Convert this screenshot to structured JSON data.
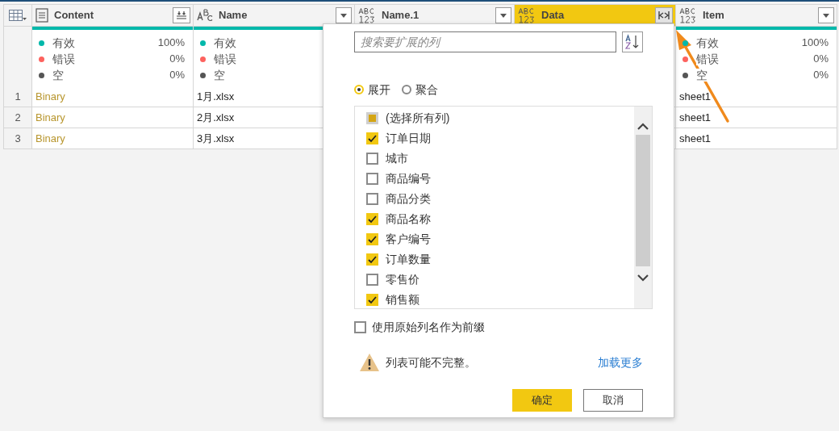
{
  "table": {
    "columns": [
      {
        "name": "Content",
        "kind": "binary",
        "header_button": {
          "kind": "expand"
        },
        "selected": false,
        "quality": [
          {
            "label": "有效",
            "value": "100%",
            "color": "#01b8aa"
          },
          {
            "label": "错误",
            "value": "0%",
            "color": "#fd625e"
          },
          {
            "label": "空",
            "value": "0%",
            "color": "#555555"
          }
        ]
      },
      {
        "name": "Name",
        "kind": "text",
        "header_button": {
          "kind": "filter"
        },
        "selected": false,
        "quality": [
          {
            "label": "有效",
            "color": "#01b8aa"
          },
          {
            "label": "错误",
            "color": "#fd625e"
          },
          {
            "label": "空",
            "color": "#555555"
          }
        ]
      },
      {
        "name": "Name.1",
        "kind": "any",
        "header_button": {
          "kind": "filter"
        },
        "selected": false
      },
      {
        "name": "Data",
        "kind": "any",
        "header_button": {
          "kind": "expand"
        },
        "selected": true
      },
      {
        "name": "Item",
        "kind": "any",
        "header_button": {
          "kind": "filter"
        },
        "selected": false,
        "quality": [
          {
            "label": "有效",
            "value": "100%",
            "color": "#01b8aa"
          },
          {
            "label": "错误",
            "value": "0%",
            "color": "#fd625e"
          },
          {
            "label": "空",
            "value": "0%",
            "color": "#555555"
          }
        ]
      }
    ],
    "rows": [
      {
        "number": "1",
        "cells": [
          "Binary",
          "1月.xlsx",
          null,
          null,
          "sheet1"
        ]
      },
      {
        "number": "2",
        "cells": [
          "Binary",
          "2月.xlsx",
          null,
          null,
          "sheet1"
        ]
      },
      {
        "number": "3",
        "cells": [
          "Binary",
          "3月.xlsx",
          null,
          null,
          "sheet1"
        ]
      }
    ]
  },
  "expand_dialog": {
    "search": {
      "placeholder": "搜索要扩展的列"
    },
    "modes": [
      {
        "label": "展开",
        "selected": true
      },
      {
        "label": "聚合",
        "selected": false
      }
    ],
    "columns": [
      {
        "label": "(选择所有列)",
        "checked": false,
        "kind": "select-all"
      },
      {
        "label": "订单日期",
        "checked": true,
        "kind": "column"
      },
      {
        "label": "城市",
        "checked": false,
        "kind": "column"
      },
      {
        "label": "商品编号",
        "checked": false,
        "kind": "column"
      },
      {
        "label": "商品分类",
        "checked": false,
        "kind": "column"
      },
      {
        "label": "商品名称",
        "checked": true,
        "kind": "column"
      },
      {
        "label": "客户编号",
        "checked": true,
        "kind": "column"
      },
      {
        "label": "订单数量",
        "checked": true,
        "kind": "column"
      },
      {
        "label": "零售价",
        "checked": false,
        "kind": "column"
      },
      {
        "label": "销售额",
        "checked": true,
        "kind": "column"
      }
    ],
    "prefix": {
      "label": "使用原始列名作为前缀",
      "checked": false
    },
    "warning": "列表可能不完整。",
    "load_more": "加载更多",
    "buttons": [
      {
        "label": "确定",
        "primary": true
      },
      {
        "label": "取消",
        "primary": false
      }
    ]
  }
}
